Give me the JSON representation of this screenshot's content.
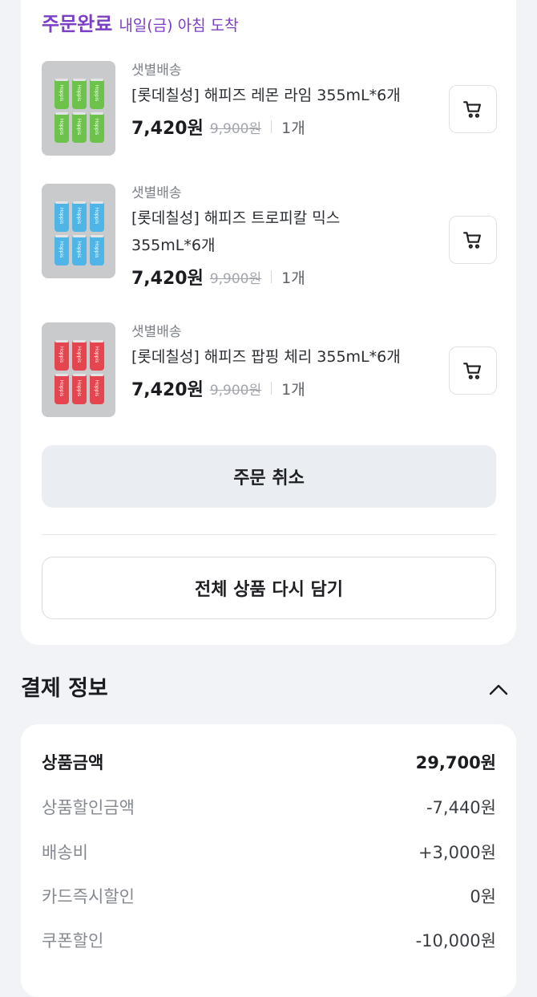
{
  "order": {
    "status": "주문완료",
    "arrival": "내일(금) 아침 도착"
  },
  "items": [
    {
      "delivery": "샛별배송",
      "name": "[롯데칠성] 해피즈 레몬 라임 355mL*6개",
      "price": "7,420원",
      "original_price": "9,900원",
      "quantity": "1개",
      "can_color": "#6cc24a",
      "can_label": "Hoppis"
    },
    {
      "delivery": "샛별배송",
      "name": "[롯데칠성] 해피즈 트로피칼 믹스 355mL*6개",
      "price": "7,420원",
      "original_price": "9,900원",
      "quantity": "1개",
      "can_color": "#4fb4e6",
      "can_label": "Hoppis"
    },
    {
      "delivery": "샛별배송",
      "name": "[롯데칠성] 해피즈 팝핑 체리 355mL*6개",
      "price": "7,420원",
      "original_price": "9,900원",
      "quantity": "1개",
      "can_color": "#e5454f",
      "can_label": "Hoppis"
    }
  ],
  "actions": {
    "cancel_label": "주문 취소",
    "readd_label": "전체 상품 다시 담기"
  },
  "payment": {
    "title": "결제 정보",
    "rows": [
      {
        "label": "상품금액",
        "value": "29,700원"
      },
      {
        "label": "상품할인금액",
        "value": "-7,440원"
      },
      {
        "label": "배송비",
        "value": "+3,000원"
      },
      {
        "label": "카드즉시할인",
        "value": "0원"
      },
      {
        "label": "쿠폰할인",
        "value": "-10,000원"
      }
    ]
  },
  "colors": {
    "accent": "#7b3fc4",
    "background": "#f2f3f6",
    "card": "#ffffff"
  },
  "icons": {
    "cart": "cart-icon",
    "collapse": "chevron-up-icon"
  }
}
